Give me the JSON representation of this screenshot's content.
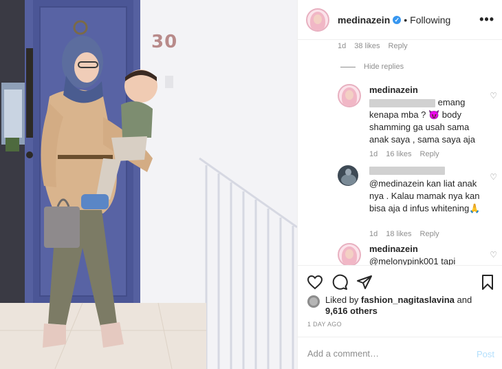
{
  "post": {
    "photo_number": "30",
    "image_alt": "Woman in hijab holding a baby in front of a blue door"
  },
  "header": {
    "username": "medinazein",
    "verified_symbol": "✓",
    "separator": "•",
    "follow_status": "Following",
    "more_icon": "•••"
  },
  "comments": {
    "top_meta": {
      "time": "1d",
      "likes": "38 likes",
      "reply": "Reply"
    },
    "hide_replies": "Hide replies",
    "items": [
      {
        "username": "medinazein",
        "text": "emang kenapa mba ? 😈 body shamming ga usah sama anak saya , sama saya aja",
        "time": "1d",
        "likes": "16 likes",
        "reply": "Reply"
      },
      {
        "username": "",
        "text": "@medinazein kan liat anak nya . Kalau mamak nya kan bisa aja d infus whitening🙏",
        "time": "1d",
        "likes": "18 likes",
        "reply": "Reply"
      },
      {
        "username": "medinazein",
        "text": "@melonypink001 tapi"
      }
    ]
  },
  "actions": {
    "like_icon": "heart-icon",
    "comment_icon": "comment-icon",
    "share_icon": "share-icon",
    "save_icon": "bookmark-icon",
    "liked_by_prefix": "Liked by",
    "liked_by_user": "fashion_nagitaslavina",
    "liked_by_and": "and",
    "others_count": "9,616 others",
    "time_ago": "1 DAY AGO"
  },
  "add_comment": {
    "placeholder": "Add a comment…",
    "post_label": "Post"
  },
  "colors": {
    "accent": "#3897f0",
    "post_disabled": "#b2dffc",
    "meta_gray": "#8e8e8e",
    "text": "#262626"
  }
}
